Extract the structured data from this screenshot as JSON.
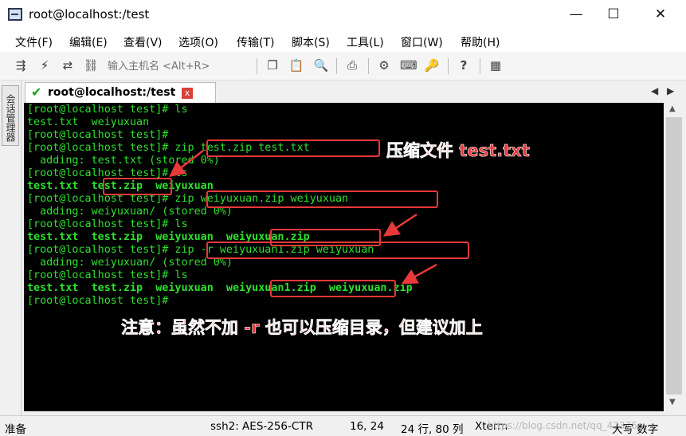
{
  "window": {
    "title": "root@localhost:/test",
    "minimize": "—",
    "maximize": "☐",
    "close": "✕"
  },
  "menu": [
    "文件(F)",
    "编辑(E)",
    "查看(V)",
    "选项(O)",
    "传输(T)",
    "脚本(S)",
    "工具(L)",
    "窗口(W)",
    "帮助(H)"
  ],
  "toolbar": {
    "host_placeholder": "输入主机名 <Alt+R>"
  },
  "sidebar": {
    "session_manager": "会话管理器"
  },
  "tab": {
    "label": "root@localhost:/test",
    "close": "x"
  },
  "terminal": {
    "lines": [
      "[root@localhost test]# ls",
      "test.txt  weiyuxuan",
      "[root@localhost test]#",
      "[root@localhost test]# zip test.zip test.txt",
      "  adding: test.txt (stored 0%)",
      "[root@localhost test]# ls",
      "test.txt  test.zip  weiyuxuan",
      "[root@localhost test]# zip weiyuxuan.zip weiyuxuan",
      "  adding: weiyuxuan/ (stored 0%)",
      "[root@localhost test]# ls",
      "test.txt  test.zip  weiyuxuan  weiyuxuan.zip",
      "[root@localhost test]# zip -r weiyuxuan1.zip weiyuxuan",
      "  adding: weiyuxuan/ (stored 0%)",
      "[root@localhost test]# ls",
      "test.txt  test.zip  weiyuxuan  weiyuxuan1.zip  weiyuxuan.zip",
      "[root@localhost test]#"
    ]
  },
  "annotations": {
    "compress_file": "压缩文件 test.txt",
    "note": "注意：虽然不加 -r 也可以压缩目录，但建议加上"
  },
  "status": {
    "ready": "准备",
    "cipher": "ssh2: AES-256-CTR",
    "cursor": "16,  24",
    "size": "24 行, 80 列",
    "term": "Xterm",
    "ime": "大写  数字",
    "watermark": "https://blog.csdn.net/qq_42376..."
  },
  "colors": {
    "terminal_bg": "#000000",
    "terminal_fg": "#2ee02e",
    "annotation": "#e8393a"
  }
}
